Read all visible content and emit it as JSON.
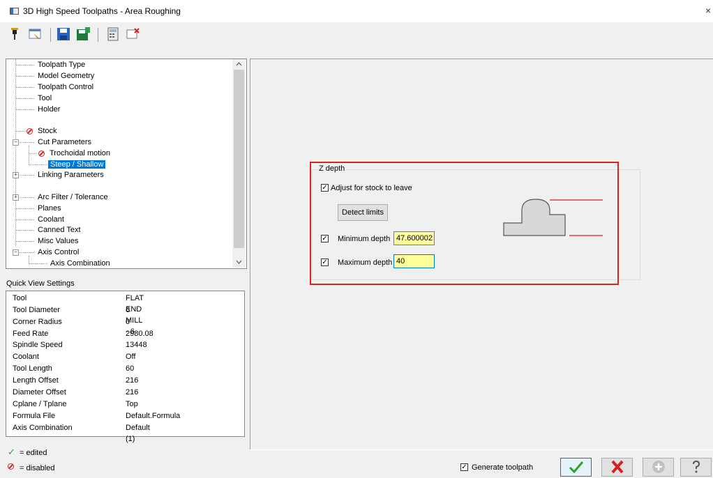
{
  "window": {
    "title": "3D High Speed Toolpaths - Area Roughing",
    "close_glyph": "×"
  },
  "toolbar": {
    "icons": [
      "tool-pin-icon",
      "view-sheet-icon",
      "save-icon",
      "save-all-icon",
      "calculator-icon",
      "clear-icon"
    ]
  },
  "tree": {
    "items": {
      "toolpath_type": "Toolpath Type",
      "model_geometry": "Model Geometry",
      "toolpath_control": "Toolpath Control",
      "tool": "Tool",
      "holder": "Holder",
      "stock": "Stock",
      "cut_parameters": "Cut Parameters",
      "trochoidal_motion": "Trochoidal motion",
      "steep_shallow": "Steep / Shallow",
      "linking_parameters": "Linking Parameters",
      "arc_filter": "Arc Filter / Tolerance",
      "planes": "Planes",
      "coolant": "Coolant",
      "canned_text": "Canned Text",
      "misc_values": "Misc Values",
      "axis_control": "Axis Control",
      "axis_combination": "Axis Combination"
    }
  },
  "quick_view": {
    "label": "Quick View Settings",
    "rows": [
      {
        "key": "Tool",
        "value": "FLAT END MILL - 6"
      },
      {
        "key": "Tool Diameter",
        "value": "6"
      },
      {
        "key": "Corner Radius",
        "value": "0"
      },
      {
        "key": "Feed Rate",
        "value": "2980.08"
      },
      {
        "key": "Spindle Speed",
        "value": "13448"
      },
      {
        "key": "Coolant",
        "value": "Off"
      },
      {
        "key": "Tool Length",
        "value": "60"
      },
      {
        "key": "Length Offset",
        "value": "216"
      },
      {
        "key": "Diameter Offset",
        "value": "216"
      },
      {
        "key": "Cplane / Tplane",
        "value": "Top"
      },
      {
        "key": "Formula File",
        "value": "Default.Formula"
      },
      {
        "key": "Axis Combination",
        "value": "Default (1)"
      }
    ]
  },
  "legend": {
    "edited": "= edited",
    "disabled": "= disabled"
  },
  "zdepth": {
    "title": "Z depth",
    "adjust_label": "Adjust for stock to leave",
    "adjust_checked": true,
    "detect_label": "Detect limits",
    "min_label": "Minimum depth",
    "min_value": "47.600002",
    "min_checked": true,
    "max_label": "Maximum depth",
    "max_value": "40",
    "max_checked": true
  },
  "footer": {
    "generate_label": "Generate toolpath",
    "generate_checked": true,
    "buttons": [
      "ok",
      "cancel",
      "add",
      "help"
    ]
  },
  "colors": {
    "accent": "#0078d7",
    "highlight_box": "#e02020",
    "edited": "#2aa52a",
    "disabled": "#d62020",
    "input_bg": "#ffff99"
  }
}
